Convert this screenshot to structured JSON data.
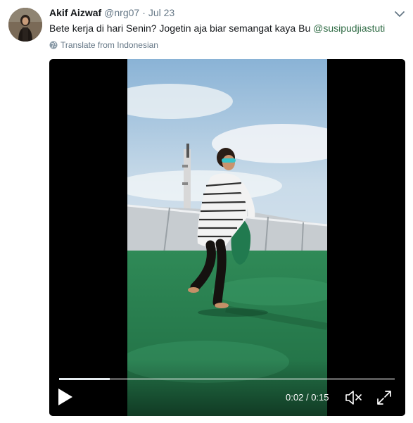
{
  "tweet": {
    "fullname": "Akif Aizwaf",
    "username": "@nrg07",
    "separator": "·",
    "time": "Jul 23",
    "text_before_mention": "Bete kerja di hari Senin? Jogetin aja biar semangat kaya Bu ",
    "mention": "@susipudjiastuti",
    "translate_label": "Translate from Indonesian",
    "avatar_icon": "user-avatar",
    "menu_icon": "chevron-down-icon"
  },
  "video": {
    "progress_fraction": 0.15,
    "current_time": "0:02",
    "time_separator": "/",
    "duration": "0:15",
    "play_icon": "play-icon",
    "mute_icon": "speaker-muted-icon",
    "fullscreen_icon": "fullscreen-icon"
  },
  "colors": {
    "mention": "#2f6b44",
    "secondary_text": "#657786",
    "video_background": "#000000"
  }
}
